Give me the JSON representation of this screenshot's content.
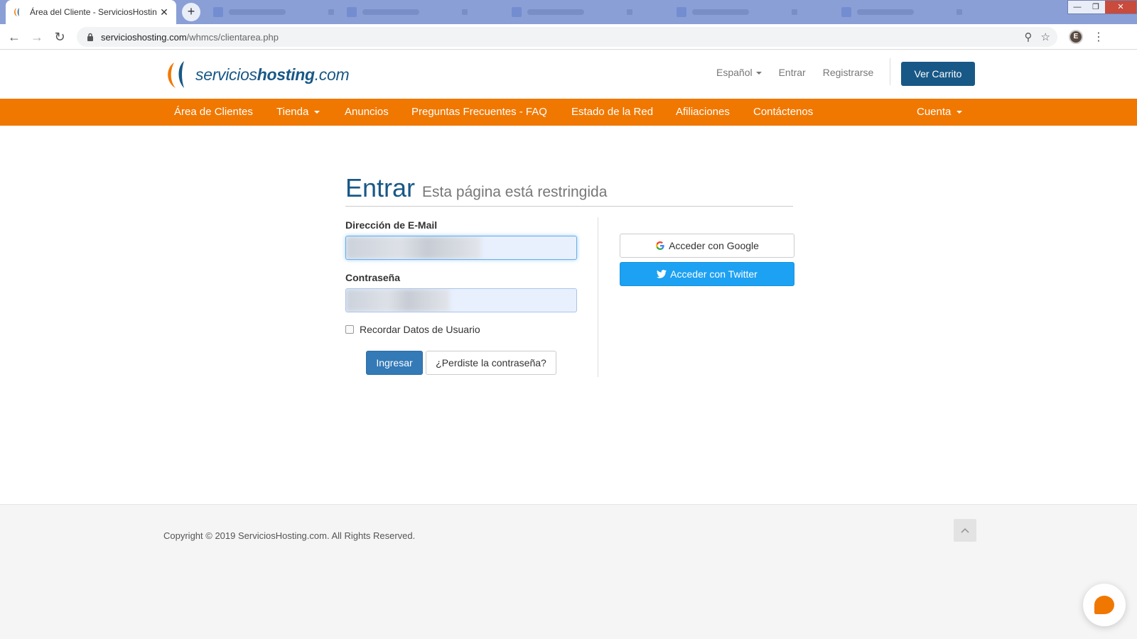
{
  "browser": {
    "tab_title": "Área del Cliente - ServiciosHostin",
    "tab_close": "✕",
    "new_tab": "+",
    "url_host": "servicioshosting.com",
    "url_path": "/whmcs/clientarea.php",
    "profile_initial": "E"
  },
  "header": {
    "logo_text_light": "servicios",
    "logo_text_bold": "hosting",
    "logo_text_suffix": ".com",
    "language": "Español",
    "login_link": "Entrar",
    "register_link": "Registrarse",
    "cart_button": "Ver Carrito"
  },
  "nav": {
    "items": [
      {
        "label": "Área de Clientes"
      },
      {
        "label": "Tienda"
      },
      {
        "label": "Anuncios"
      },
      {
        "label": "Preguntas Frecuentes - FAQ"
      },
      {
        "label": "Estado de la Red"
      },
      {
        "label": "Afiliaciones"
      },
      {
        "label": "Contáctenos"
      }
    ],
    "account": "Cuenta"
  },
  "login": {
    "title": "Entrar",
    "subtitle": "Esta página está restringida",
    "email_label": "Dirección de E-Mail",
    "password_label": "Contraseña",
    "remember_label": "Recordar Datos de Usuario",
    "submit_button": "Ingresar",
    "forgot_button": "¿Perdiste la contraseña?",
    "google_button": "Acceder con Google",
    "twitter_button": "Acceder con Twitter"
  },
  "footer": {
    "copyright": "Copyright © 2019 ServiciosHosting.com. All Rights Reserved."
  },
  "colors": {
    "brand_blue": "#185886",
    "nav_orange": "#f07800",
    "twitter_blue": "#1da1f2",
    "primary_button": "#337ab7"
  }
}
